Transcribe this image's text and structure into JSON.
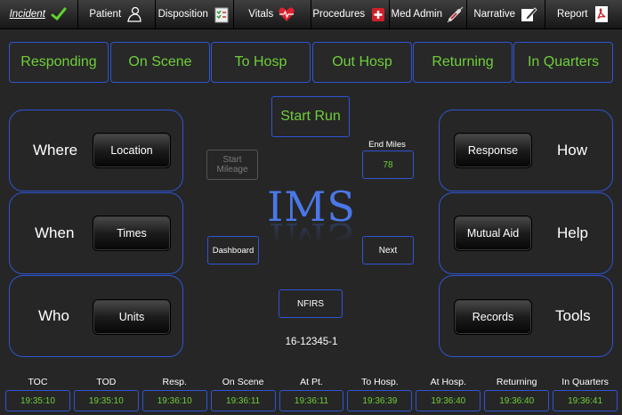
{
  "tabs": [
    {
      "label": "Incident",
      "icon": "checkmark-icon",
      "active": true
    },
    {
      "label": "Patient",
      "icon": "person-outline-icon"
    },
    {
      "label": "Disposition",
      "icon": "clipboard-icon"
    },
    {
      "label": "Vitals",
      "icon": "heart-icon"
    },
    {
      "label": "Procedures",
      "icon": "medical-kit-icon"
    },
    {
      "label": "Med Admin",
      "icon": "syringe-icon"
    },
    {
      "label": "Narrative",
      "icon": "pencil-note-icon"
    },
    {
      "label": "Report",
      "icon": "pdf-icon"
    }
  ],
  "statuses": [
    "Responding",
    "On Scene",
    "To Hosp",
    "Out Hosp",
    "Returning",
    "In Quarters"
  ],
  "left_panels": [
    {
      "label": "Where",
      "button": "Location"
    },
    {
      "label": "When",
      "button": "Times"
    },
    {
      "label": "Who",
      "button": "Units"
    }
  ],
  "right_panels": [
    {
      "label": "How",
      "button": "Response"
    },
    {
      "label": "Help",
      "button": "Mutual Aid"
    },
    {
      "label": "Tools",
      "button": "Records"
    }
  ],
  "center": {
    "start_run": "Start Run",
    "start_mileage": "Start Mileage",
    "end_miles_label": "End Miles",
    "end_miles_value": "78",
    "logo": "IMS",
    "dashboard": "Dashboard",
    "next": "Next",
    "nfirs": "NFIRS",
    "run_number": "16-12345-1"
  },
  "times": [
    {
      "label": "TOC",
      "value": "19:35:10"
    },
    {
      "label": "TOD",
      "value": "19:35:10"
    },
    {
      "label": "Resp.",
      "value": "19:36:10"
    },
    {
      "label": "On Scene",
      "value": "19:36:11"
    },
    {
      "label": "At Pt.",
      "value": "19:36:11"
    },
    {
      "label": "To Hosp.",
      "value": "19:36:39"
    },
    {
      "label": "At Hosp.",
      "value": "19:36:40"
    },
    {
      "label": "Returning",
      "value": "19:36:40"
    },
    {
      "label": "In Quarters",
      "value": "19:36:41"
    }
  ],
  "colors": {
    "accent_border": "#2f55d4",
    "status_text": "#6fcf3a",
    "logo": "#4a78e8",
    "background": "#262626"
  }
}
